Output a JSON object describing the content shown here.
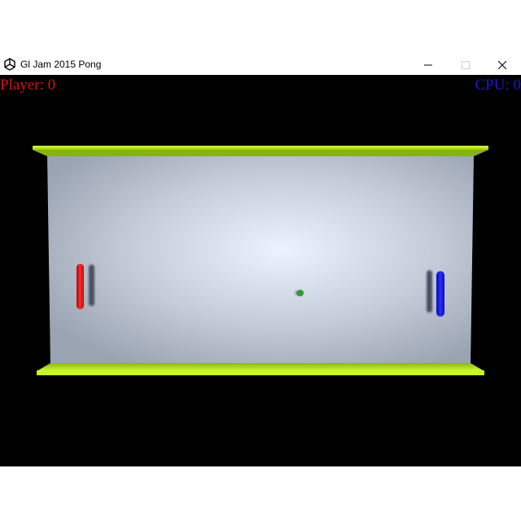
{
  "window": {
    "title": "Gl Jam 2015 Pong",
    "icon": "unity-logo-icon",
    "controls": [
      "minimize-icon",
      "maximize-icon",
      "close-icon"
    ]
  },
  "hud": {
    "player_score_text": "Player: 0",
    "cpu_score_text": "CPU: 0"
  },
  "colors": {
    "player_paddle": "#e81c1c",
    "cpu_paddle": "#1a1aff",
    "walls": "#b7ff1e",
    "arena_floor": "#e8f0ff",
    "ball": "#2e9a2e",
    "background": "#000000"
  }
}
